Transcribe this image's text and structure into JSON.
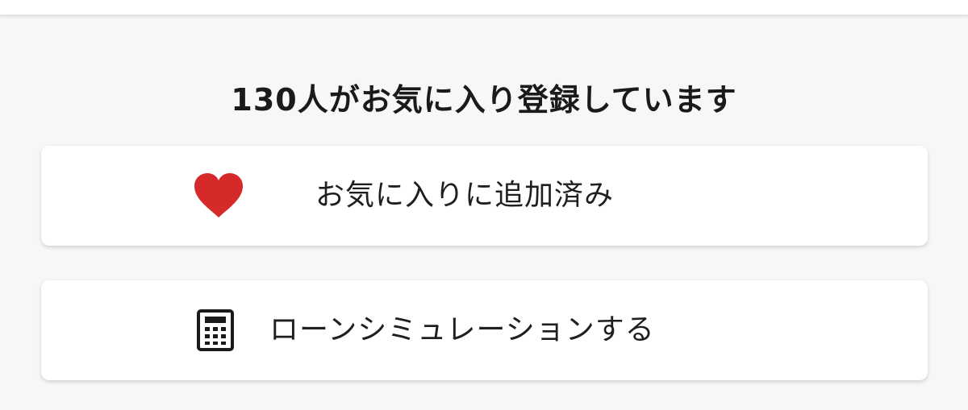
{
  "favorites": {
    "count_text": "130人がお気に入り登録しています",
    "button_label": "お気に入りに追加済み",
    "icon": "heart-icon",
    "icon_color": "#d62a2a"
  },
  "loan": {
    "button_label": "ローンシミュレーションする",
    "icon": "calculator-icon",
    "icon_color": "#1a1a1a"
  }
}
